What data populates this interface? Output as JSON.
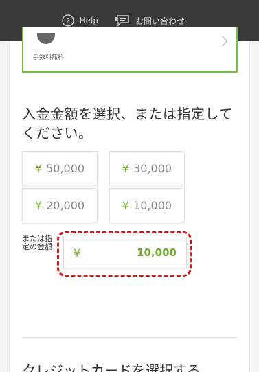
{
  "header": {
    "help_label": "Help",
    "help_icon": "question-circle-icon",
    "contact_label": "お問い合わせ",
    "contact_icon": "chat-bubble-icon"
  },
  "fee_card": {
    "fee_text": "手数料無料"
  },
  "amount_section": {
    "title": "入金金額を選択、または指定してください。",
    "options": [
      {
        "currency": "¥",
        "amount": "50,000"
      },
      {
        "currency": "¥",
        "amount": "30,000"
      },
      {
        "currency": "¥",
        "amount": "20,000"
      },
      {
        "currency": "¥",
        "amount": "10,000"
      }
    ],
    "custom_label": "または指定の金額",
    "custom_currency": "¥",
    "custom_value": "10,000"
  },
  "next_section": {
    "title": "クレジットカードを選択する"
  },
  "colors": {
    "header_bg": "#3a3a3a",
    "accent_green": "#78b833",
    "highlight_red": "#d11a1a"
  }
}
